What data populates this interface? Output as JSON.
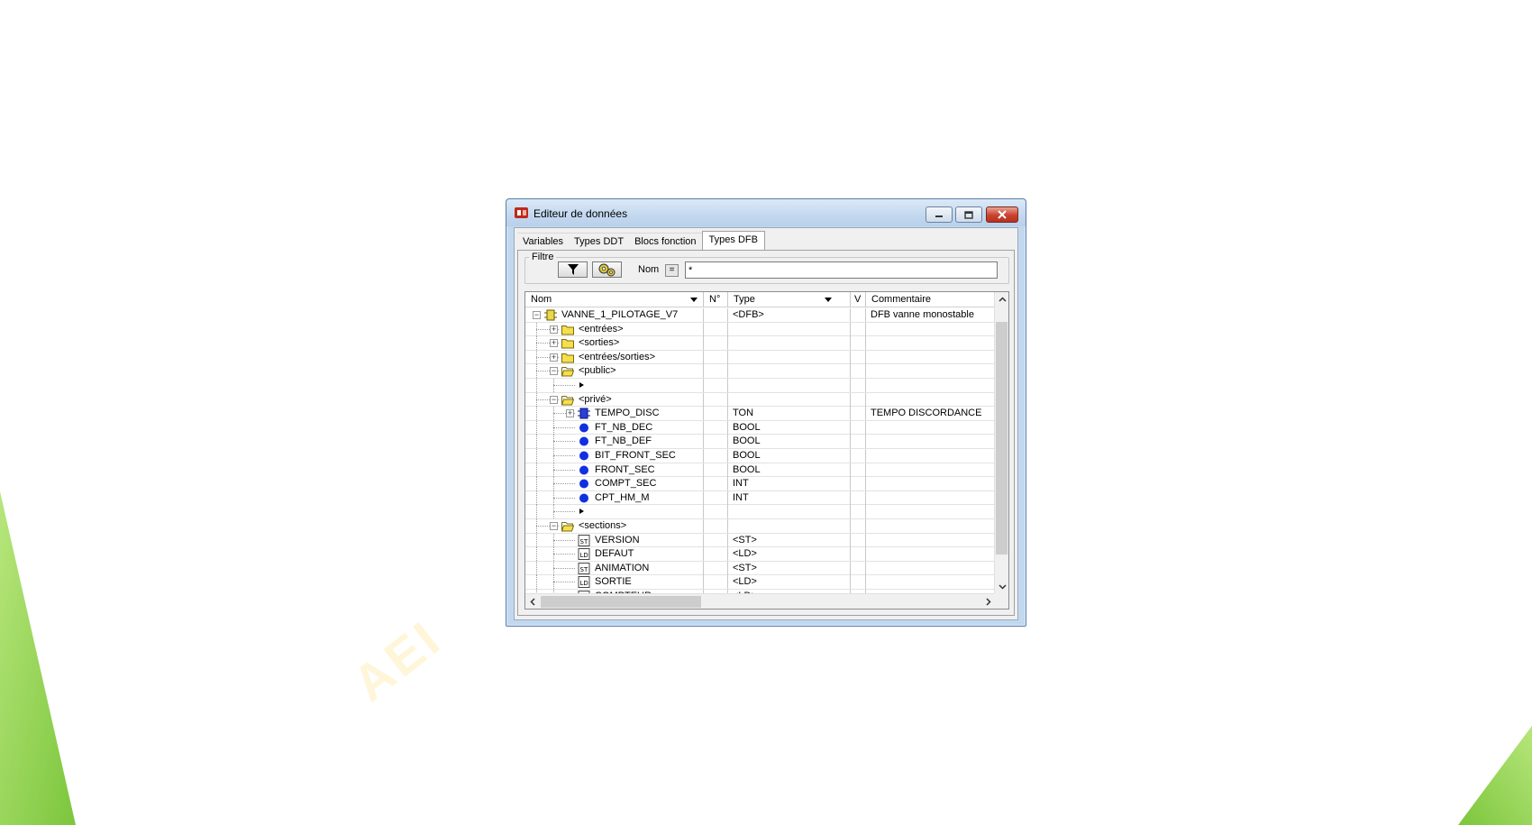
{
  "window": {
    "title": "Editeur de données"
  },
  "tabs": [
    "Variables",
    "Types DDT",
    "Blocs fonction",
    "Types DFB"
  ],
  "active_tab": 3,
  "filter": {
    "group_label": "Filtre",
    "name_label": "Nom",
    "eq_label": "=",
    "value": "*"
  },
  "columns": [
    "Nom",
    "N°",
    "Type",
    "V",
    "Commentaire"
  ],
  "rows": [
    {
      "name": "VANNE_1_PILOTAGE_V7",
      "level": 0,
      "expander": "minus",
      "icon": "dfb-block-icon",
      "type": "<DFB>",
      "comment": "DFB vanne monostable"
    },
    {
      "name": "<entrées>",
      "level": 1,
      "expander": "plus",
      "icon": "folder-closed-icon",
      "type": "",
      "comment": ""
    },
    {
      "name": "<sorties>",
      "level": 1,
      "expander": "plus",
      "icon": "folder-closed-icon",
      "type": "",
      "comment": ""
    },
    {
      "name": "<entrées/sorties>",
      "level": 1,
      "expander": "plus",
      "icon": "folder-closed-icon",
      "type": "",
      "comment": ""
    },
    {
      "name": "<public>",
      "level": 1,
      "expander": "minus",
      "icon": "folder-open-icon",
      "type": "",
      "comment": ""
    },
    {
      "name": "",
      "level": 2,
      "expander": "",
      "icon": "new-entry-arrow-icon",
      "type": "",
      "comment": ""
    },
    {
      "name": "<privé>",
      "level": 1,
      "expander": "minus",
      "icon": "folder-open-icon",
      "type": "",
      "comment": ""
    },
    {
      "name": "TEMPO_DISC",
      "level": 2,
      "expander": "plus",
      "icon": "function-block-icon",
      "type": "TON",
      "comment": "TEMPO DISCORDANCE"
    },
    {
      "name": "FT_NB_DEC",
      "level": 2,
      "expander": "",
      "icon": "variable-dot-icon",
      "type": "BOOL",
      "comment": ""
    },
    {
      "name": "FT_NB_DEF",
      "level": 2,
      "expander": "",
      "icon": "variable-dot-icon",
      "type": "BOOL",
      "comment": ""
    },
    {
      "name": "BIT_FRONT_SEC",
      "level": 2,
      "expander": "",
      "icon": "variable-dot-icon",
      "type": "BOOL",
      "comment": ""
    },
    {
      "name": "FRONT_SEC",
      "level": 2,
      "expander": "",
      "icon": "variable-dot-icon",
      "type": "BOOL",
      "comment": ""
    },
    {
      "name": "COMPT_SEC",
      "level": 2,
      "expander": "",
      "icon": "variable-dot-icon",
      "type": "INT",
      "comment": ""
    },
    {
      "name": "CPT_HM_M",
      "level": 2,
      "expander": "",
      "icon": "variable-dot-icon",
      "type": "INT",
      "comment": ""
    },
    {
      "name": "",
      "level": 2,
      "expander": "",
      "icon": "new-entry-arrow-icon",
      "type": "",
      "comment": ""
    },
    {
      "name": "<sections>",
      "level": 1,
      "expander": "minus",
      "icon": "folder-open-icon",
      "type": "",
      "comment": ""
    },
    {
      "name": "VERSION",
      "level": 2,
      "expander": "",
      "icon": "st-section-icon",
      "type": "<ST>",
      "comment": ""
    },
    {
      "name": "DEFAUT",
      "level": 2,
      "expander": "",
      "icon": "ld-section-icon",
      "type": "<LD>",
      "comment": ""
    },
    {
      "name": "ANIMATION",
      "level": 2,
      "expander": "",
      "icon": "st-section-icon",
      "type": "<ST>",
      "comment": ""
    },
    {
      "name": "SORTIE",
      "level": 2,
      "expander": "",
      "icon": "ld-section-icon",
      "type": "<LD>",
      "comment": ""
    },
    {
      "name": "COMPTEUR",
      "level": 2,
      "expander": "",
      "icon": "ld-section-icon",
      "type": "<LD>",
      "comment": ""
    }
  ],
  "watermark": "AEI",
  "colors": {
    "accent_green": "#8fd14f",
    "folder_yellow": "#f5e04a",
    "variable_blue": "#1030e0",
    "close_red": "#c8432e"
  },
  "scroll": {
    "vertical_fraction": 0.78,
    "horizontal_fraction": 0.36
  }
}
